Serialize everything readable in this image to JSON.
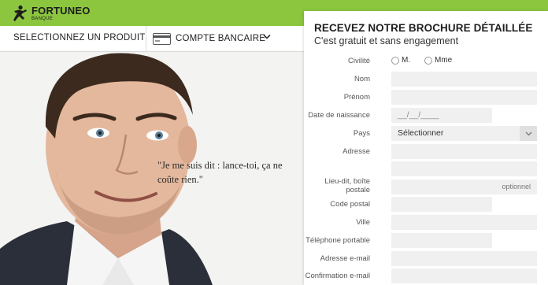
{
  "brand": {
    "name": "FORTUNEO",
    "tagline": "BANQUE",
    "logo_icon": "running-man-icon",
    "bar_color": "#8cc63f"
  },
  "product_bar": {
    "select_label": "SELECTIONNEZ UN PRODUIT",
    "product_icon": "bank-card-icon",
    "product_value": "COMPTE BANCAIRE",
    "chevron_icon": "chevron-down-icon"
  },
  "hero": {
    "quote": "\"Je me suis dit : lance-toi, ça ne coûte rien.\""
  },
  "form": {
    "title": "RECEVEZ NOTRE BROCHURE DÉTAILLÉE",
    "subtitle": "C'est gratuit et sans engagement",
    "civilite": {
      "label": "Civilité",
      "options": [
        "M.",
        "Mme"
      ]
    },
    "fields": [
      {
        "key": "nom",
        "label": "Nom",
        "value": ""
      },
      {
        "key": "prenom",
        "label": "Prénom",
        "value": ""
      },
      {
        "key": "date",
        "label": "Date de naissance",
        "placeholder": "__/__/____"
      },
      {
        "key": "pays",
        "label": "Pays",
        "value": "Sélectionner"
      },
      {
        "key": "adresse",
        "label": "Adresse",
        "value": ""
      },
      {
        "key": "lieudit",
        "label": "Lieu-dit, boîte postale",
        "placeholder": "optionnel"
      },
      {
        "key": "cp",
        "label": "Code postal",
        "value": ""
      },
      {
        "key": "ville",
        "label": "Ville",
        "value": ""
      },
      {
        "key": "tel",
        "label": "Téléphone portable",
        "value": ""
      },
      {
        "key": "email",
        "label": "Adresse e-mail",
        "value": ""
      },
      {
        "key": "email2",
        "label": "Confirmation e-mail",
        "value": ""
      }
    ]
  }
}
